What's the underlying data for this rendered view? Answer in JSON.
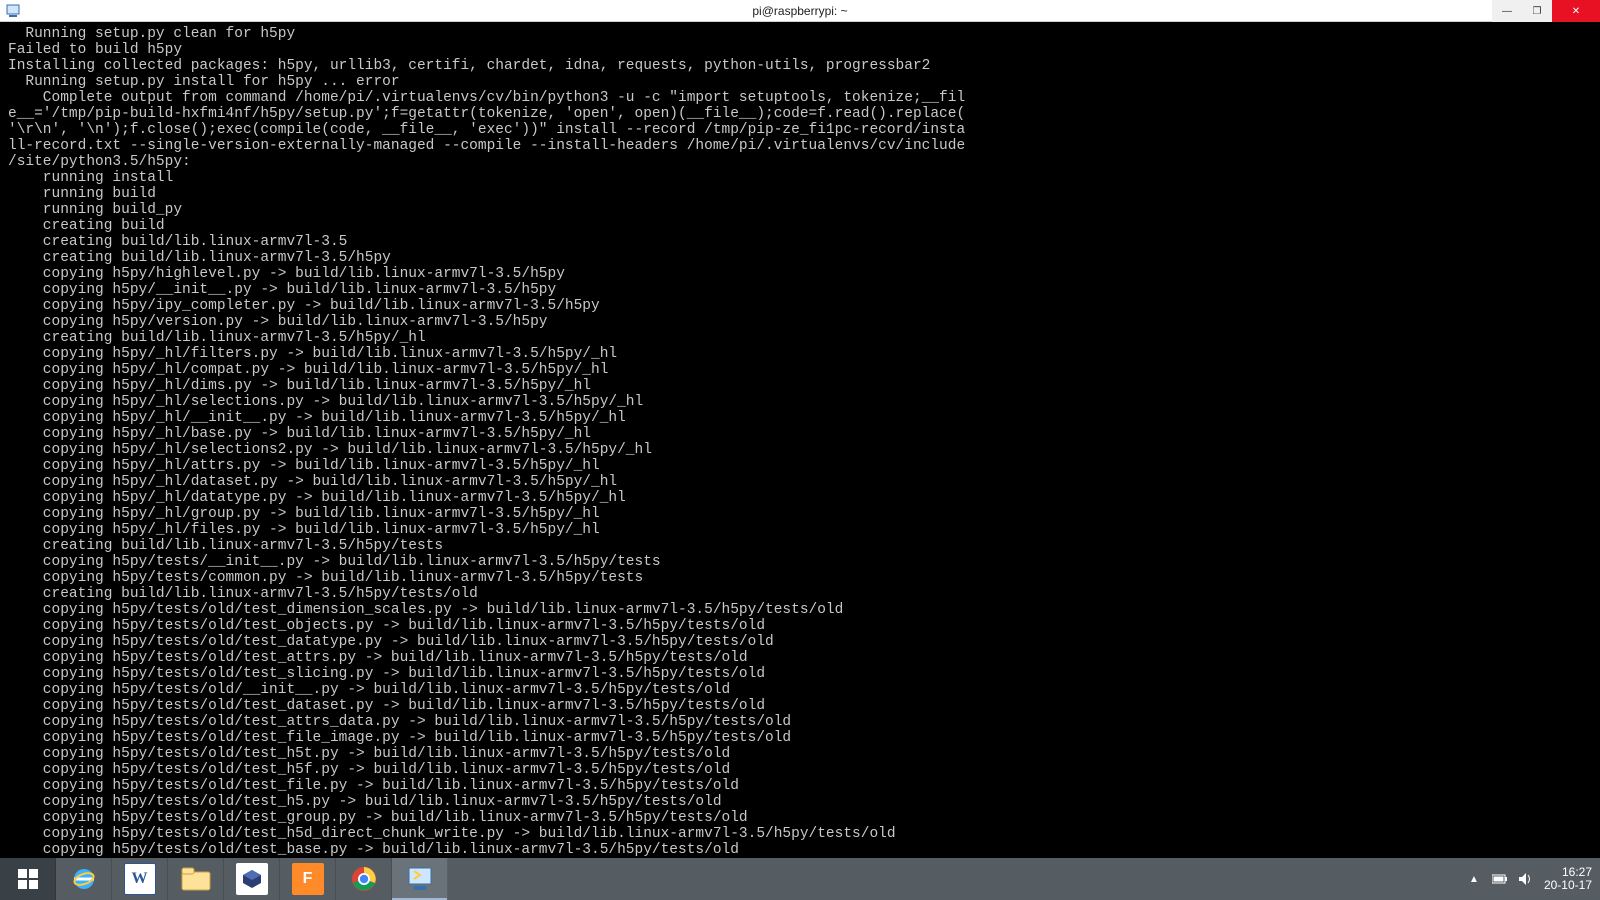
{
  "window": {
    "title": "pi@raspberrypi: ~",
    "app_icon": "putty-icon"
  },
  "window_controls": {
    "min_glyph": "—",
    "max_glyph": "❐",
    "close_glyph": "✕"
  },
  "terminal_lines": [
    "  Running setup.py clean for h5py",
    "Failed to build h5py",
    "Installing collected packages: h5py, urllib3, certifi, chardet, idna, requests, python-utils, progressbar2",
    "  Running setup.py install for h5py ... error",
    "    Complete output from command /home/pi/.virtualenvs/cv/bin/python3 -u -c \"import setuptools, tokenize;__fil",
    "e__='/tmp/pip-build-hxfmi4nf/h5py/setup.py';f=getattr(tokenize, 'open', open)(__file__);code=f.read().replace(",
    "'\\r\\n', '\\n');f.close();exec(compile(code, __file__, 'exec'))\" install --record /tmp/pip-ze_fi1pc-record/insta",
    "ll-record.txt --single-version-externally-managed --compile --install-headers /home/pi/.virtualenvs/cv/include",
    "/site/python3.5/h5py:",
    "    running install",
    "    running build",
    "    running build_py",
    "    creating build",
    "    creating build/lib.linux-armv7l-3.5",
    "    creating build/lib.linux-armv7l-3.5/h5py",
    "    copying h5py/highlevel.py -> build/lib.linux-armv7l-3.5/h5py",
    "    copying h5py/__init__.py -> build/lib.linux-armv7l-3.5/h5py",
    "    copying h5py/ipy_completer.py -> build/lib.linux-armv7l-3.5/h5py",
    "    copying h5py/version.py -> build/lib.linux-armv7l-3.5/h5py",
    "    creating build/lib.linux-armv7l-3.5/h5py/_hl",
    "    copying h5py/_hl/filters.py -> build/lib.linux-armv7l-3.5/h5py/_hl",
    "    copying h5py/_hl/compat.py -> build/lib.linux-armv7l-3.5/h5py/_hl",
    "    copying h5py/_hl/dims.py -> build/lib.linux-armv7l-3.5/h5py/_hl",
    "    copying h5py/_hl/selections.py -> build/lib.linux-armv7l-3.5/h5py/_hl",
    "    copying h5py/_hl/__init__.py -> build/lib.linux-armv7l-3.5/h5py/_hl",
    "    copying h5py/_hl/base.py -> build/lib.linux-armv7l-3.5/h5py/_hl",
    "    copying h5py/_hl/selections2.py -> build/lib.linux-armv7l-3.5/h5py/_hl",
    "    copying h5py/_hl/attrs.py -> build/lib.linux-armv7l-3.5/h5py/_hl",
    "    copying h5py/_hl/dataset.py -> build/lib.linux-armv7l-3.5/h5py/_hl",
    "    copying h5py/_hl/datatype.py -> build/lib.linux-armv7l-3.5/h5py/_hl",
    "    copying h5py/_hl/group.py -> build/lib.linux-armv7l-3.5/h5py/_hl",
    "    copying h5py/_hl/files.py -> build/lib.linux-armv7l-3.5/h5py/_hl",
    "    creating build/lib.linux-armv7l-3.5/h5py/tests",
    "    copying h5py/tests/__init__.py -> build/lib.linux-armv7l-3.5/h5py/tests",
    "    copying h5py/tests/common.py -> build/lib.linux-armv7l-3.5/h5py/tests",
    "    creating build/lib.linux-armv7l-3.5/h5py/tests/old",
    "    copying h5py/tests/old/test_dimension_scales.py -> build/lib.linux-armv7l-3.5/h5py/tests/old",
    "    copying h5py/tests/old/test_objects.py -> build/lib.linux-armv7l-3.5/h5py/tests/old",
    "    copying h5py/tests/old/test_datatype.py -> build/lib.linux-armv7l-3.5/h5py/tests/old",
    "    copying h5py/tests/old/test_attrs.py -> build/lib.linux-armv7l-3.5/h5py/tests/old",
    "    copying h5py/tests/old/test_slicing.py -> build/lib.linux-armv7l-3.5/h5py/tests/old",
    "    copying h5py/tests/old/__init__.py -> build/lib.linux-armv7l-3.5/h5py/tests/old",
    "    copying h5py/tests/old/test_dataset.py -> build/lib.linux-armv7l-3.5/h5py/tests/old",
    "    copying h5py/tests/old/test_attrs_data.py -> build/lib.linux-armv7l-3.5/h5py/tests/old",
    "    copying h5py/tests/old/test_file_image.py -> build/lib.linux-armv7l-3.5/h5py/tests/old",
    "    copying h5py/tests/old/test_h5t.py -> build/lib.linux-armv7l-3.5/h5py/tests/old",
    "    copying h5py/tests/old/test_h5f.py -> build/lib.linux-armv7l-3.5/h5py/tests/old",
    "    copying h5py/tests/old/test_file.py -> build/lib.linux-armv7l-3.5/h5py/tests/old",
    "    copying h5py/tests/old/test_h5.py -> build/lib.linux-armv7l-3.5/h5py/tests/old",
    "    copying h5py/tests/old/test_group.py -> build/lib.linux-armv7l-3.5/h5py/tests/old",
    "    copying h5py/tests/old/test_h5d_direct_chunk_write.py -> build/lib.linux-armv7l-3.5/h5py/tests/old",
    "    copying h5py/tests/old/test_base.py -> build/lib.linux-armv7l-3.5/h5py/tests/old"
  ],
  "taskbar": {
    "items": [
      {
        "name": "start",
        "icon": "windows-start-icon"
      },
      {
        "name": "ie",
        "icon": "internet-explorer-icon"
      },
      {
        "name": "word",
        "icon": "word-icon"
      },
      {
        "name": "file-explorer",
        "icon": "file-explorer-icon"
      },
      {
        "name": "virtualbox",
        "icon": "virtualbox-icon"
      },
      {
        "name": "freemake",
        "icon": "freemake-icon"
      },
      {
        "name": "chrome",
        "icon": "chrome-icon"
      },
      {
        "name": "putty",
        "icon": "putty-icon",
        "active": true
      }
    ]
  },
  "tray": {
    "time": "16:27",
    "date": "20-10-17",
    "show_hidden_glyph": "▲",
    "battery_glyph": "▮",
    "volume_glyph": "🔊"
  }
}
